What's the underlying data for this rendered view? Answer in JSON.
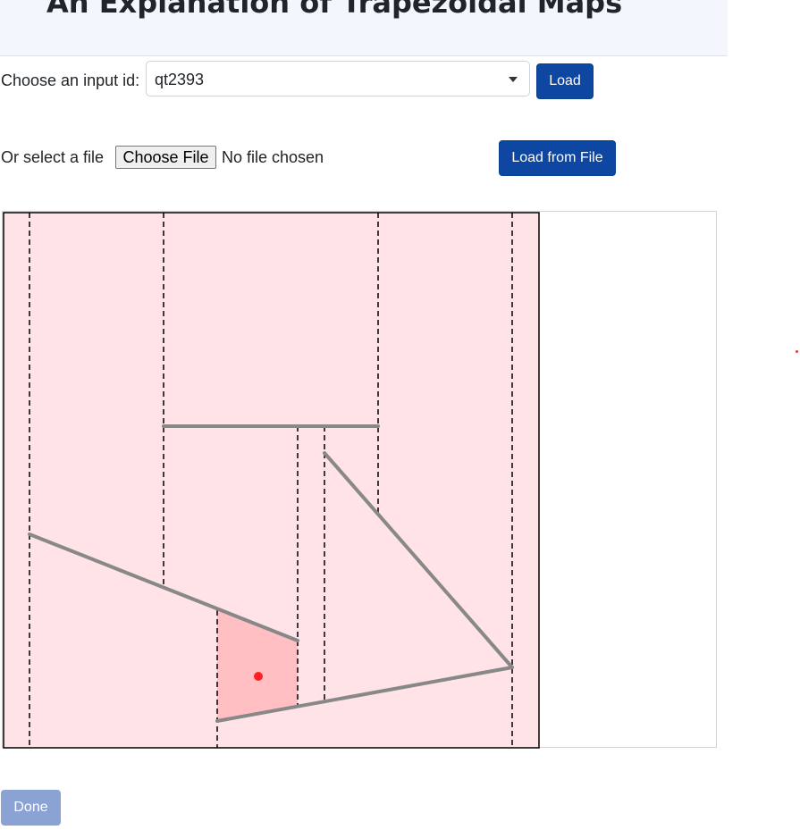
{
  "page": {
    "title": "An Explanation of Trapezoidal Maps"
  },
  "input_row": {
    "label": "Choose an input id:",
    "selected": "qt2393",
    "load_label": "Load"
  },
  "file_row": {
    "label": "Or select a file",
    "choose_label": "Choose File",
    "status": "No file chosen",
    "load_file_label": "Load from File"
  },
  "done_label": "Done",
  "colors": {
    "region_fill": "#ffe3e6",
    "highlight_fill": "#ffbfc3",
    "segment": "#888888",
    "query_point": "#ff2020",
    "primary": "#0d47a1"
  }
}
